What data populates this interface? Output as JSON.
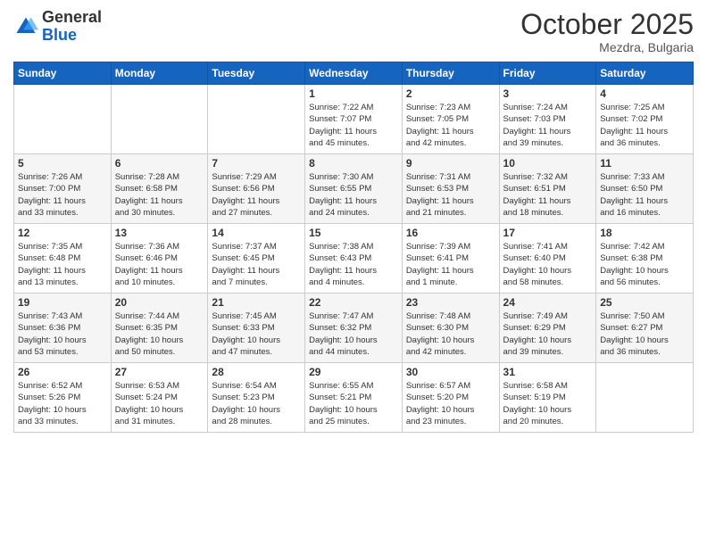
{
  "header": {
    "logo_general": "General",
    "logo_blue": "Blue",
    "month_title": "October 2025",
    "location": "Mezdra, Bulgaria"
  },
  "weekdays": [
    "Sunday",
    "Monday",
    "Tuesday",
    "Wednesday",
    "Thursday",
    "Friday",
    "Saturday"
  ],
  "weeks": [
    [
      {
        "day": "",
        "info": ""
      },
      {
        "day": "",
        "info": ""
      },
      {
        "day": "",
        "info": ""
      },
      {
        "day": "1",
        "info": "Sunrise: 7:22 AM\nSunset: 7:07 PM\nDaylight: 11 hours\nand 45 minutes."
      },
      {
        "day": "2",
        "info": "Sunrise: 7:23 AM\nSunset: 7:05 PM\nDaylight: 11 hours\nand 42 minutes."
      },
      {
        "day": "3",
        "info": "Sunrise: 7:24 AM\nSunset: 7:03 PM\nDaylight: 11 hours\nand 39 minutes."
      },
      {
        "day": "4",
        "info": "Sunrise: 7:25 AM\nSunset: 7:02 PM\nDaylight: 11 hours\nand 36 minutes."
      }
    ],
    [
      {
        "day": "5",
        "info": "Sunrise: 7:26 AM\nSunset: 7:00 PM\nDaylight: 11 hours\nand 33 minutes."
      },
      {
        "day": "6",
        "info": "Sunrise: 7:28 AM\nSunset: 6:58 PM\nDaylight: 11 hours\nand 30 minutes."
      },
      {
        "day": "7",
        "info": "Sunrise: 7:29 AM\nSunset: 6:56 PM\nDaylight: 11 hours\nand 27 minutes."
      },
      {
        "day": "8",
        "info": "Sunrise: 7:30 AM\nSunset: 6:55 PM\nDaylight: 11 hours\nand 24 minutes."
      },
      {
        "day": "9",
        "info": "Sunrise: 7:31 AM\nSunset: 6:53 PM\nDaylight: 11 hours\nand 21 minutes."
      },
      {
        "day": "10",
        "info": "Sunrise: 7:32 AM\nSunset: 6:51 PM\nDaylight: 11 hours\nand 18 minutes."
      },
      {
        "day": "11",
        "info": "Sunrise: 7:33 AM\nSunset: 6:50 PM\nDaylight: 11 hours\nand 16 minutes."
      }
    ],
    [
      {
        "day": "12",
        "info": "Sunrise: 7:35 AM\nSunset: 6:48 PM\nDaylight: 11 hours\nand 13 minutes."
      },
      {
        "day": "13",
        "info": "Sunrise: 7:36 AM\nSunset: 6:46 PM\nDaylight: 11 hours\nand 10 minutes."
      },
      {
        "day": "14",
        "info": "Sunrise: 7:37 AM\nSunset: 6:45 PM\nDaylight: 11 hours\nand 7 minutes."
      },
      {
        "day": "15",
        "info": "Sunrise: 7:38 AM\nSunset: 6:43 PM\nDaylight: 11 hours\nand 4 minutes."
      },
      {
        "day": "16",
        "info": "Sunrise: 7:39 AM\nSunset: 6:41 PM\nDaylight: 11 hours\nand 1 minute."
      },
      {
        "day": "17",
        "info": "Sunrise: 7:41 AM\nSunset: 6:40 PM\nDaylight: 10 hours\nand 58 minutes."
      },
      {
        "day": "18",
        "info": "Sunrise: 7:42 AM\nSunset: 6:38 PM\nDaylight: 10 hours\nand 56 minutes."
      }
    ],
    [
      {
        "day": "19",
        "info": "Sunrise: 7:43 AM\nSunset: 6:36 PM\nDaylight: 10 hours\nand 53 minutes."
      },
      {
        "day": "20",
        "info": "Sunrise: 7:44 AM\nSunset: 6:35 PM\nDaylight: 10 hours\nand 50 minutes."
      },
      {
        "day": "21",
        "info": "Sunrise: 7:45 AM\nSunset: 6:33 PM\nDaylight: 10 hours\nand 47 minutes."
      },
      {
        "day": "22",
        "info": "Sunrise: 7:47 AM\nSunset: 6:32 PM\nDaylight: 10 hours\nand 44 minutes."
      },
      {
        "day": "23",
        "info": "Sunrise: 7:48 AM\nSunset: 6:30 PM\nDaylight: 10 hours\nand 42 minutes."
      },
      {
        "day": "24",
        "info": "Sunrise: 7:49 AM\nSunset: 6:29 PM\nDaylight: 10 hours\nand 39 minutes."
      },
      {
        "day": "25",
        "info": "Sunrise: 7:50 AM\nSunset: 6:27 PM\nDaylight: 10 hours\nand 36 minutes."
      }
    ],
    [
      {
        "day": "26",
        "info": "Sunrise: 6:52 AM\nSunset: 5:26 PM\nDaylight: 10 hours\nand 33 minutes."
      },
      {
        "day": "27",
        "info": "Sunrise: 6:53 AM\nSunset: 5:24 PM\nDaylight: 10 hours\nand 31 minutes."
      },
      {
        "day": "28",
        "info": "Sunrise: 6:54 AM\nSunset: 5:23 PM\nDaylight: 10 hours\nand 28 minutes."
      },
      {
        "day": "29",
        "info": "Sunrise: 6:55 AM\nSunset: 5:21 PM\nDaylight: 10 hours\nand 25 minutes."
      },
      {
        "day": "30",
        "info": "Sunrise: 6:57 AM\nSunset: 5:20 PM\nDaylight: 10 hours\nand 23 minutes."
      },
      {
        "day": "31",
        "info": "Sunrise: 6:58 AM\nSunset: 5:19 PM\nDaylight: 10 hours\nand 20 minutes."
      },
      {
        "day": "",
        "info": ""
      }
    ]
  ]
}
